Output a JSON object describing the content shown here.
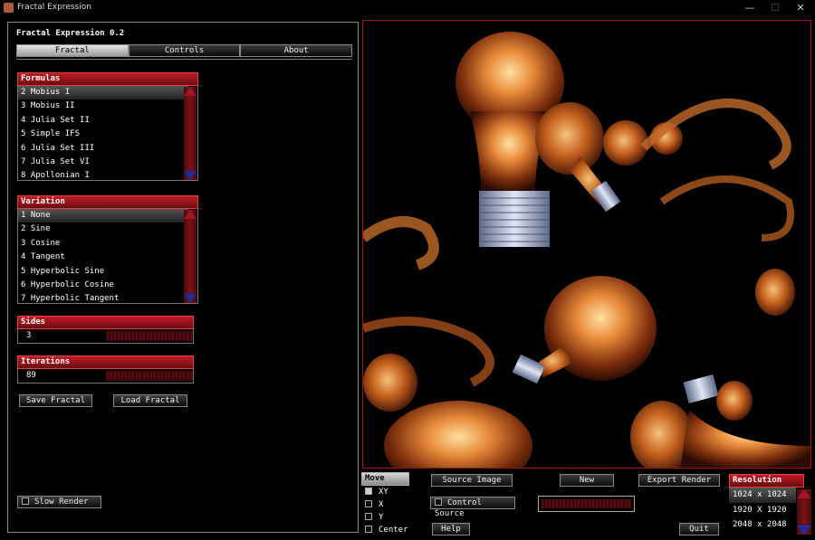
{
  "window": {
    "title": "Fractal Expression",
    "minimize_label": "—",
    "maximize_label": "☐",
    "close_label": "✕"
  },
  "app_title": "Fractal Expression 0.2",
  "tabs": [
    {
      "label": "Fractal"
    },
    {
      "label": "Controls"
    },
    {
      "label": "About"
    }
  ],
  "formulas": {
    "header": "Formulas",
    "items": [
      "2 Mobius I",
      "3 Mobius II",
      "4 Julia Set II",
      "5 Simple IFS",
      "6 Julia Set III",
      "7 Julia Set VI",
      "8 Apollonian I"
    ]
  },
  "variation": {
    "header": "Variation",
    "items": [
      "1 None",
      "2 Sine",
      "3 Cosine",
      "4 Tangent",
      "5 Hyperbolic Sine",
      "6 Hyperbolic Cosine",
      "7 Hyperbolic Tangent"
    ]
  },
  "sides": {
    "header": "Sides",
    "value": "3"
  },
  "iterations": {
    "header": "Iterations",
    "value": "89"
  },
  "buttons": {
    "save_fractal": "Save Fractal",
    "load_fractal": "Load Fractal",
    "slow_render": "Slow Render",
    "source_image": "Source Image",
    "new": "New",
    "export_render": "Export Render",
    "control_source": "Control Source",
    "help": "Help",
    "quit": "Quit"
  },
  "move": {
    "header": "Move",
    "items": [
      "XY",
      "X",
      "Y",
      "Center"
    ]
  },
  "resolution": {
    "header": "Resolution",
    "items": [
      "1024 x 1024",
      "1920 X 1920",
      "2048 x 2048"
    ]
  },
  "colors": {
    "accent_red": "#c21a24",
    "scroll_up": "#a2162b",
    "scroll_down": "#1d2d9e",
    "canvas_border": "#a01218"
  }
}
